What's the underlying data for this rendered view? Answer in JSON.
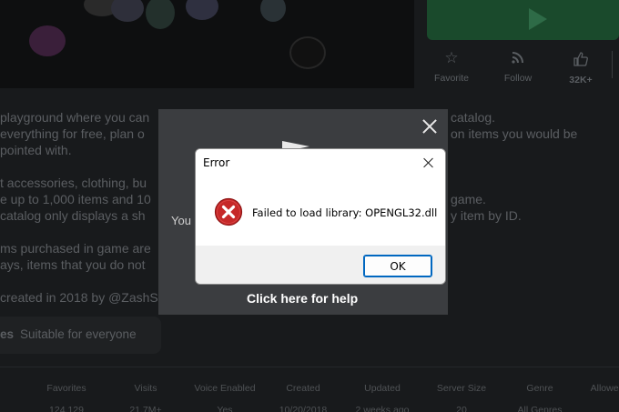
{
  "background": {
    "actions": [
      {
        "label": "Favorite",
        "icon": "star-icon"
      },
      {
        "label": "Follow",
        "icon": "rss-icon"
      },
      {
        "label": "32K+",
        "icon": "thumbs-up-icon"
      }
    ],
    "description_lines": [
      "playground where you can",
      "everything for free, plan o",
      "pointed with.",
      "t accessories, clothing, bu",
      "e up to 1,000 items and 10",
      "catalog only displays a sh",
      "ms purchased in game are",
      "ays, items that you do not",
      "created in 2018 by @ZashS"
    ],
    "description_right": [
      "catalog.",
      "on items you would be",
      "game.",
      "y item by ID."
    ],
    "tag_label": "es",
    "tag_value": "Suitable for everyone",
    "stats": {
      "headers": [
        "Favorites",
        "Visits",
        "Voice Enabled",
        "Created",
        "Updated",
        "Server Size",
        "Genre",
        "Allowed"
      ],
      "values": [
        "124,129",
        "21.7M+",
        "Yes",
        "10/20/2018",
        "2 weeks ago",
        "20",
        "All Genres",
        ""
      ]
    }
  },
  "overlay": {
    "side_text": "You",
    "help_link": "Click here for help"
  },
  "dialog": {
    "title": "Error",
    "message": "Failed to load library: OPENGL32.dll",
    "ok_label": "OK"
  },
  "colors": {
    "error_red": "#c62828",
    "focus_blue": "#0067c0",
    "play_green": "#1a4a2c"
  }
}
